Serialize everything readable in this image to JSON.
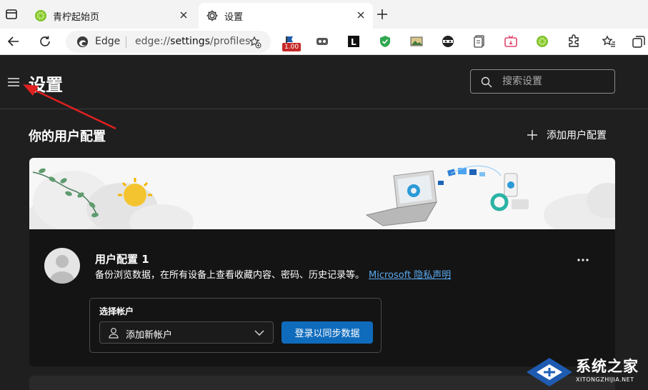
{
  "browser": {
    "tabs": [
      {
        "title": "青柠起始页",
        "active": false,
        "favicon": "lime-icon"
      },
      {
        "title": "设置",
        "active": true,
        "favicon": "gear-icon"
      }
    ],
    "address": {
      "brand": "Edge",
      "url_prefix": "edge://",
      "url_host": "settings",
      "url_path": "/profiles"
    },
    "extension_badge": "1.00"
  },
  "header": {
    "title": "设置",
    "search_placeholder": "搜索设置"
  },
  "profiles": {
    "section_title": "你的用户配置",
    "add_profile_label": "添加用户配置",
    "card": {
      "name": "用户配置 1",
      "description": "备份浏览数据，在所有设备上查看收藏内容、密码、历史记录等。",
      "privacy_link": "Microsoft 隐私声明",
      "account_label": "选择帐户",
      "account_value": "添加新帐户",
      "signin_button": "登录以同步数据"
    }
  },
  "watermark": {
    "text": "系统之家",
    "sub": "XITONGZHIJIA.NET"
  },
  "colors": {
    "accent": "#0f6cbd",
    "link": "#5aa9f0",
    "annotation_arrow": "#e02020"
  }
}
